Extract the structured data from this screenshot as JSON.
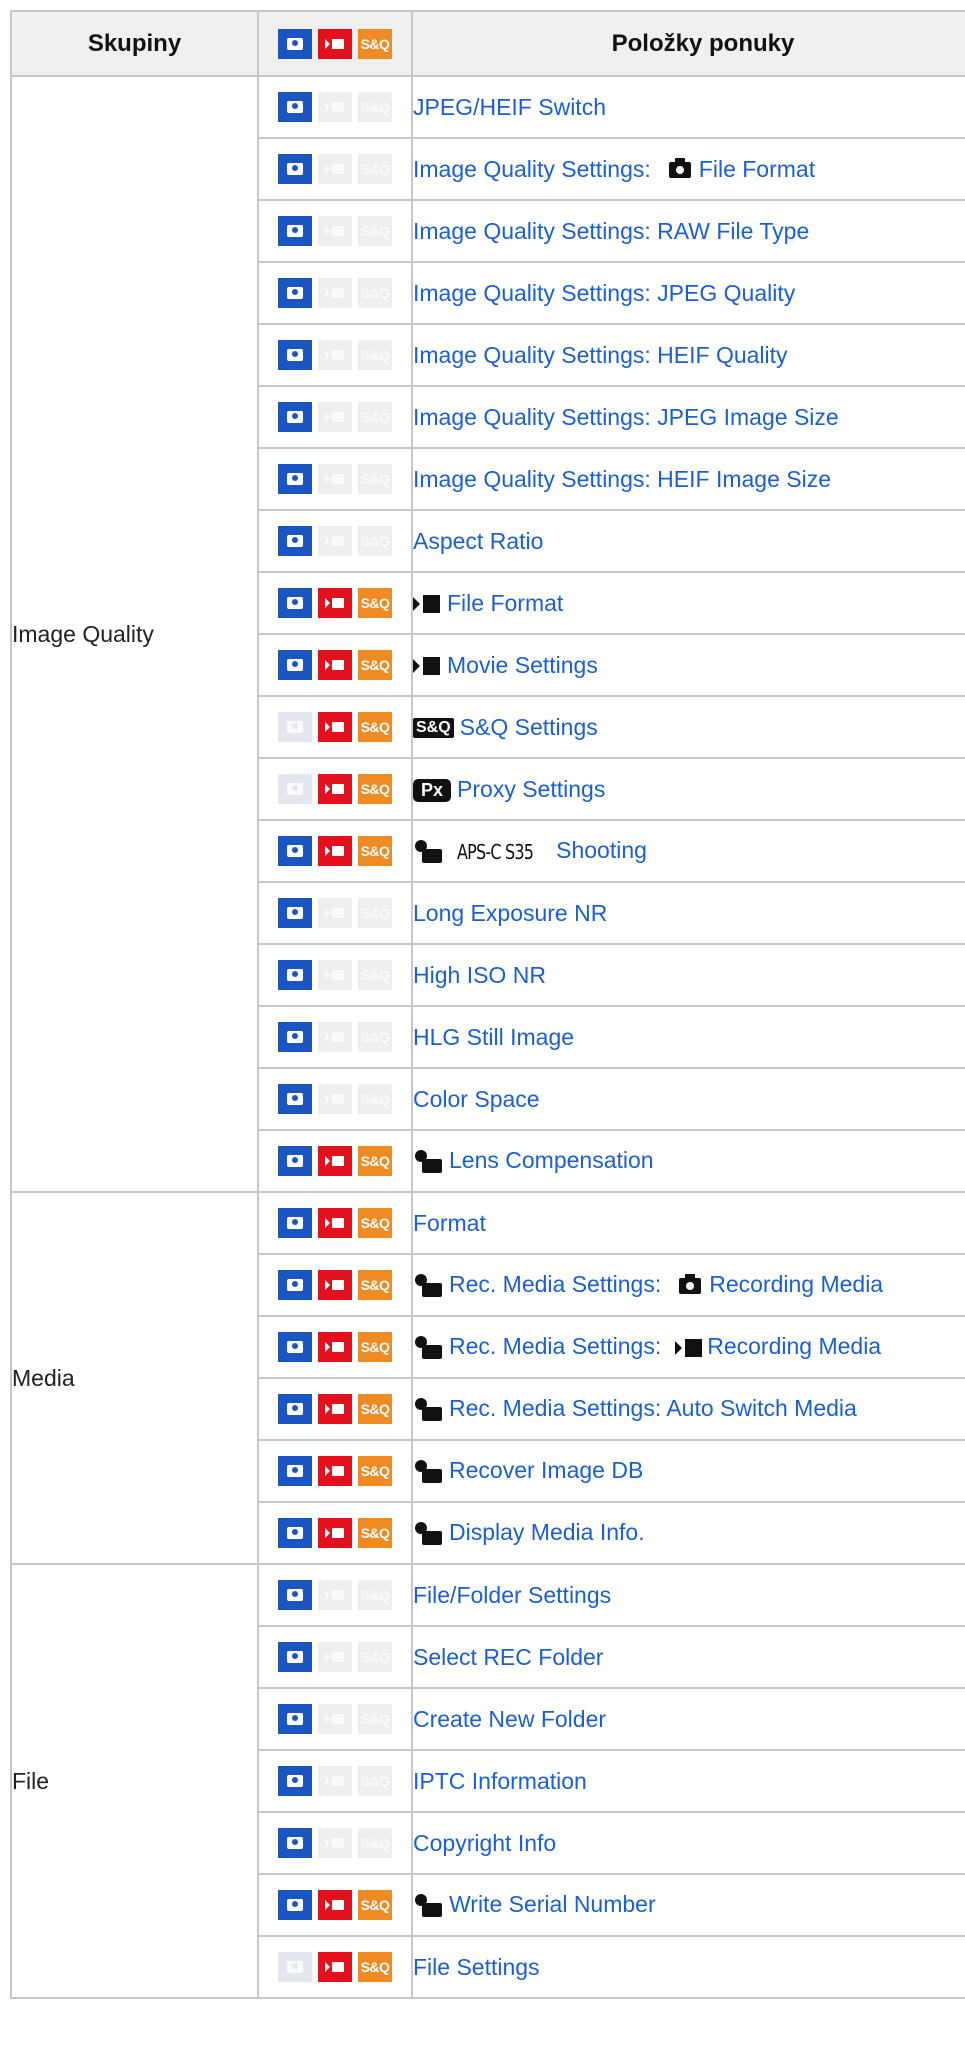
{
  "headers": {
    "groups": "Skupiny",
    "icons": [
      "camera-icon",
      "movie-icon",
      "sq-icon"
    ],
    "items": "Položky ponuky"
  },
  "icon_text": {
    "sq": "S&Q",
    "px": "Px",
    "aps": "APS-C S35"
  },
  "colors": {
    "photo": "#1b55c1",
    "movie": "#e3101e",
    "sq": "#f08a23",
    "link": "#1a5fd6",
    "disabled": "#eeeeee",
    "header_bg": "#f0f0f0",
    "border": "#c7c7c7"
  },
  "groups": [
    {
      "name": "Image Quality",
      "rows": [
        {
          "modes": [
            1,
            0,
            0
          ],
          "prefix": [],
          "label": "JPEG/HEIF Switch"
        },
        {
          "modes": [
            1,
            0,
            0
          ],
          "prefix": [],
          "label": "Image Quality Settings:",
          "mid": "cam",
          "label2": "File Format"
        },
        {
          "modes": [
            1,
            0,
            0
          ],
          "prefix": [],
          "label": "Image Quality Settings: RAW File Type"
        },
        {
          "modes": [
            1,
            0,
            0
          ],
          "prefix": [],
          "label": "Image Quality Settings: JPEG Quality"
        },
        {
          "modes": [
            1,
            0,
            0
          ],
          "prefix": [],
          "label": "Image Quality Settings: HEIF Quality"
        },
        {
          "modes": [
            1,
            0,
            0
          ],
          "prefix": [],
          "label": "Image Quality Settings: JPEG Image Size"
        },
        {
          "modes": [
            1,
            0,
            0
          ],
          "prefix": [],
          "label": "Image Quality Settings: HEIF Image Size"
        },
        {
          "modes": [
            1,
            0,
            0
          ],
          "prefix": [],
          "label": "Aspect Ratio"
        },
        {
          "modes": [
            1,
            1,
            1
          ],
          "prefix": [
            "mov"
          ],
          "label": "File Format"
        },
        {
          "modes": [
            1,
            1,
            1
          ],
          "prefix": [
            "mov"
          ],
          "label": "Movie Settings"
        },
        {
          "modes": [
            0,
            1,
            1
          ],
          "prefix": [
            "sq"
          ],
          "label": "S&Q Settings"
        },
        {
          "modes": [
            0,
            1,
            1
          ],
          "prefix": [
            "px"
          ],
          "label": "Proxy Settings"
        },
        {
          "modes": [
            1,
            1,
            1
          ],
          "prefix": [
            "ms",
            "aps"
          ],
          "label": "Shooting"
        },
        {
          "modes": [
            1,
            0,
            0
          ],
          "prefix": [],
          "label": "Long Exposure NR"
        },
        {
          "modes": [
            1,
            0,
            0
          ],
          "prefix": [],
          "label": "High ISO NR"
        },
        {
          "modes": [
            1,
            0,
            0
          ],
          "prefix": [],
          "label": "HLG Still Image"
        },
        {
          "modes": [
            1,
            0,
            0
          ],
          "prefix": [],
          "label": "Color Space"
        },
        {
          "modes": [
            1,
            1,
            1
          ],
          "prefix": [
            "ms"
          ],
          "label": "Lens Compensation"
        }
      ]
    },
    {
      "name": "Media",
      "rows": [
        {
          "modes": [
            1,
            1,
            1
          ],
          "prefix": [],
          "label": "Format"
        },
        {
          "modes": [
            1,
            1,
            1
          ],
          "prefix": [
            "ms"
          ],
          "label": "Rec. Media Settings:",
          "mid": "cam",
          "label2": "Recording Media"
        },
        {
          "modes": [
            1,
            1,
            1
          ],
          "prefix": [
            "ms"
          ],
          "label": "Rec. Media Settings:",
          "mid": "mov",
          "label2": "Recording Media"
        },
        {
          "modes": [
            1,
            1,
            1
          ],
          "prefix": [
            "ms"
          ],
          "label": "Rec. Media Settings: Auto Switch Media"
        },
        {
          "modes": [
            1,
            1,
            1
          ],
          "prefix": [
            "ms"
          ],
          "label": "Recover Image DB"
        },
        {
          "modes": [
            1,
            1,
            1
          ],
          "prefix": [
            "ms"
          ],
          "label": "Display Media Info."
        }
      ]
    },
    {
      "name": "File",
      "rows": [
        {
          "modes": [
            1,
            0,
            0
          ],
          "prefix": [],
          "label": "File/Folder Settings"
        },
        {
          "modes": [
            1,
            0,
            0
          ],
          "prefix": [],
          "label": "Select REC Folder"
        },
        {
          "modes": [
            1,
            0,
            0
          ],
          "prefix": [],
          "label": "Create New Folder"
        },
        {
          "modes": [
            1,
            0,
            0
          ],
          "prefix": [],
          "label": "IPTC Information"
        },
        {
          "modes": [
            1,
            0,
            0
          ],
          "prefix": [],
          "label": "Copyright Info"
        },
        {
          "modes": [
            1,
            1,
            1
          ],
          "prefix": [
            "ms"
          ],
          "label": "Write Serial Number"
        },
        {
          "modes": [
            0,
            1,
            1
          ],
          "prefix": [],
          "label": "File Settings"
        }
      ]
    }
  ]
}
